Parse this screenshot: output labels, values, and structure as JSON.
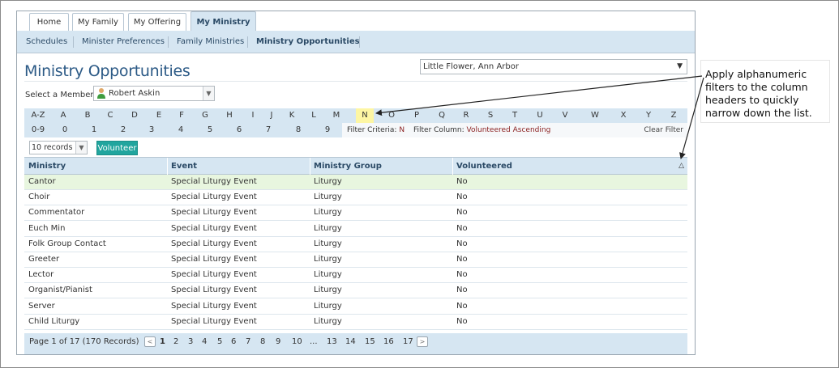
{
  "tabs": [
    "Home",
    "My Family",
    "My Offering",
    "My Ministry"
  ],
  "subnav": [
    "Schedules",
    "Minister Preferences",
    "Family Ministries",
    "Ministry Opportunities"
  ],
  "page_title": "Ministry Opportunities",
  "parish": "Little Flower, Ann Arbor",
  "member_label": "Select a Member:",
  "member": "Robert Askin",
  "letters": [
    "A-Z",
    "A",
    "B",
    "C",
    "D",
    "E",
    "F",
    "G",
    "H",
    "I",
    "J",
    "K",
    "L",
    "M",
    "N",
    "O",
    "P",
    "Q",
    "R",
    "S",
    "T",
    "U",
    "V",
    "W",
    "X",
    "Y",
    "Z"
  ],
  "digits": [
    "0-9",
    "0",
    "1",
    "2",
    "3",
    "4",
    "5",
    "6",
    "7",
    "8",
    "9"
  ],
  "selected_filter": "N",
  "filter_criteria_label": "Filter Criteria:",
  "filter_criteria_value": "N",
  "filter_column_label": "Filter Column:",
  "filter_column_value": "Volunteered Ascending",
  "clear_filter": "Clear Filter",
  "records_option": "10 records",
  "volunteer_label": "Volunteer",
  "columns": [
    "Ministry",
    "Event",
    "Ministry Group",
    "Volunteered"
  ],
  "rows": [
    [
      "Cantor",
      "Special Liturgy Event",
      "Liturgy",
      "No"
    ],
    [
      "Choir",
      "Special Liturgy Event",
      "Liturgy",
      "No"
    ],
    [
      "Commentator",
      "Special Liturgy Event",
      "Liturgy",
      "No"
    ],
    [
      "Euch Min",
      "Special Liturgy Event",
      "Liturgy",
      "No"
    ],
    [
      "Folk Group Contact",
      "Special Liturgy Event",
      "Liturgy",
      "No"
    ],
    [
      "Greeter",
      "Special Liturgy Event",
      "Liturgy",
      "No"
    ],
    [
      "Lector",
      "Special Liturgy Event",
      "Liturgy",
      "No"
    ],
    [
      "Organist/Pianist",
      "Special Liturgy Event",
      "Liturgy",
      "No"
    ],
    [
      "Server",
      "Special Liturgy Event",
      "Liturgy",
      "No"
    ],
    [
      "Child Liturgy",
      "Special Liturgy Event",
      "Liturgy",
      "No"
    ]
  ],
  "pager_info": "Page 1 of 17 (170 Records)",
  "pages": [
    "1",
    "2",
    "3",
    "4",
    "5",
    "6",
    "7",
    "8",
    "9",
    "10",
    "...",
    "13",
    "14",
    "15",
    "16",
    "17"
  ],
  "current_page": "1",
  "callout_text": "Apply alphanumeric filters to the column headers to quickly narrow down the list.",
  "colors": {
    "accent": "#2c5a86",
    "bar": "#d6e6f2",
    "highlight": "#fdf6a3",
    "button": "#21a59e",
    "row_selected": "#e8f6df"
  }
}
